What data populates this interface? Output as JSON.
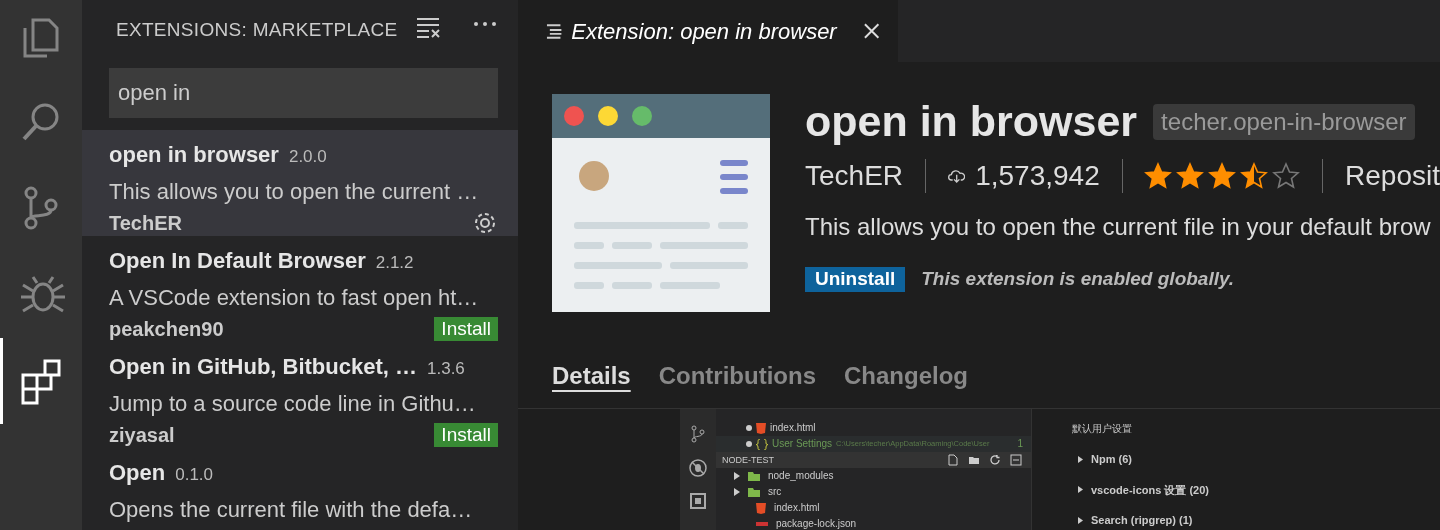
{
  "activity_bar": {
    "items": [
      {
        "kind": "files",
        "selected": false
      },
      {
        "kind": "search",
        "selected": false
      },
      {
        "kind": "scm",
        "selected": false
      },
      {
        "kind": "debug",
        "selected": false
      },
      {
        "kind": "extensions",
        "selected": true
      }
    ]
  },
  "sidebar": {
    "title": "EXTENSIONS: MARKETPLACE",
    "search": {
      "value": "open in"
    },
    "extensions": [
      {
        "name": "open in browser",
        "version": "2.0.0",
        "description": "This allows you to open the current …",
        "publisher": "TechER",
        "installed": true,
        "selected": true
      },
      {
        "name": "Open In Default Browser",
        "version": "2.1.2",
        "description": "A VSCode extension to fast open ht…",
        "publisher": "peakchen90",
        "installed": false,
        "action": "Install",
        "selected": false
      },
      {
        "name": "Open in GitHub, Bitbucket, …",
        "version": "1.3.6",
        "description": "Jump to a source code line in Githu…",
        "publisher": "ziyasal",
        "installed": false,
        "action": "Install",
        "selected": false
      },
      {
        "name": "Open",
        "version": "0.1.0",
        "description": "Opens the current file with the defa…",
        "selected": false
      }
    ]
  },
  "editor": {
    "tab": {
      "title": "Extension: open in browser"
    },
    "extension": {
      "name": "open in browser",
      "id": "techer.open-in-browser",
      "publisher": "TechER",
      "downloads": "1,573,942",
      "stars": 3.5,
      "repository": "Reposit",
      "description": "This allows you to open the current file in your default brow",
      "button": "Uninstall",
      "status": "This extension is enabled globally."
    },
    "detail_tabs": [
      {
        "label": "Details",
        "selected": true
      },
      {
        "label": "Contributions",
        "selected": false
      },
      {
        "label": "Changelog",
        "selected": false
      }
    ],
    "readme_screenshot": {
      "open_editors": [
        {
          "kind": "html",
          "label": "index.html"
        },
        {
          "kind": "settings",
          "label": "User Settings",
          "path": "C:\\Users\\techer\\AppData\\Roaming\\Code\\User",
          "count": "1"
        }
      ],
      "folder": "NODE-TEST",
      "files": [
        {
          "kind": "folder",
          "label": "node_modules"
        },
        {
          "kind": "folder",
          "label": "src"
        },
        {
          "kind": "html",
          "label": "index.html"
        },
        {
          "kind": "json",
          "label": "package-lock.json"
        }
      ],
      "settings_heading": "默认用户设置",
      "settings_groups": [
        "Npm (6)",
        "vscode-icons 设置 (20)",
        "Search (ripgrep) (1)"
      ]
    }
  }
}
